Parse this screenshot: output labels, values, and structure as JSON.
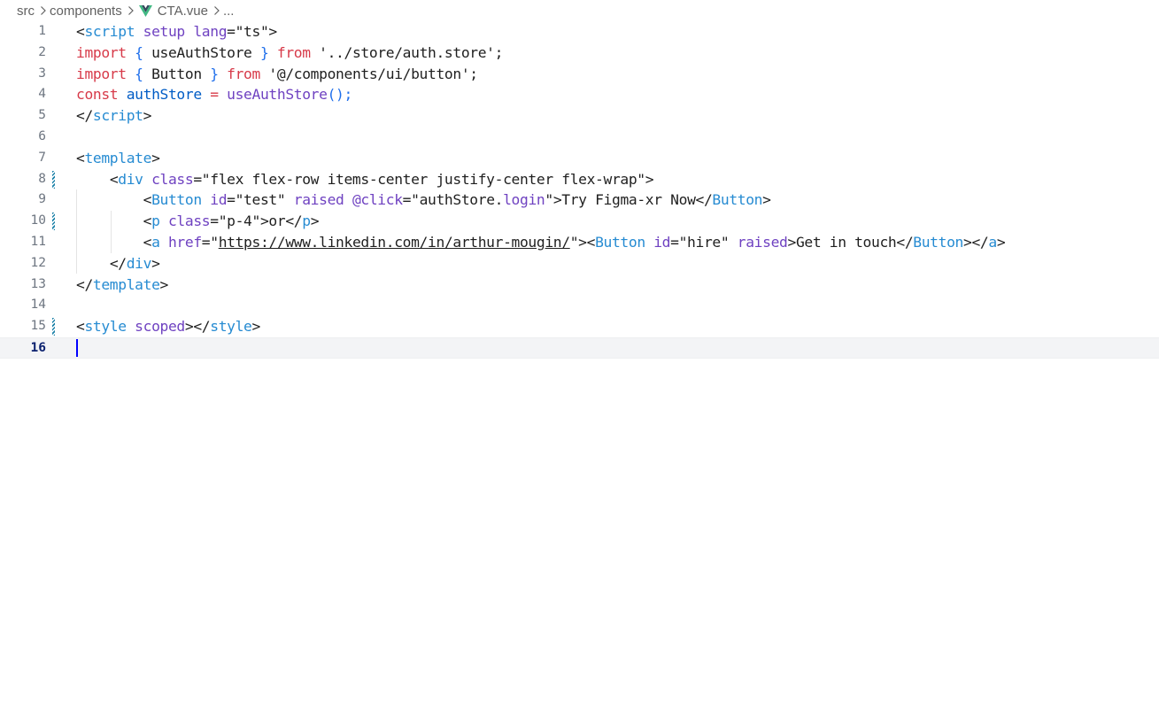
{
  "breadcrumb": {
    "items": [
      "src",
      "components",
      "CTA.vue",
      "..."
    ]
  },
  "editor": {
    "active_line": 16,
    "lines": [
      {
        "num": "1",
        "modified": false
      },
      {
        "num": "2",
        "modified": false
      },
      {
        "num": "3",
        "modified": false
      },
      {
        "num": "4",
        "modified": false
      },
      {
        "num": "5",
        "modified": false
      },
      {
        "num": "6",
        "modified": false
      },
      {
        "num": "7",
        "modified": false
      },
      {
        "num": "8",
        "modified": true
      },
      {
        "num": "9",
        "modified": false
      },
      {
        "num": "10",
        "modified": true
      },
      {
        "num": "11",
        "modified": false
      },
      {
        "num": "12",
        "modified": false
      },
      {
        "num": "13",
        "modified": false
      },
      {
        "num": "14",
        "modified": false
      },
      {
        "num": "15",
        "modified": true
      },
      {
        "num": "16",
        "modified": false
      }
    ],
    "code": {
      "l1": [
        "<",
        "script",
        " ",
        "setup",
        " ",
        "lang",
        "=",
        "\"ts\"",
        ">"
      ],
      "l2": [
        "import",
        " ",
        "{",
        " useAuthStore ",
        "}",
        " ",
        "from",
        " ",
        "'../store/auth.store'",
        ";"
      ],
      "l3": [
        "import",
        " ",
        "{",
        " Button ",
        "}",
        " ",
        "from",
        " ",
        "'@/components/ui/button'",
        ";"
      ],
      "l4": [
        "const",
        " ",
        "authStore",
        " ",
        "=",
        " ",
        "useAuthStore",
        "();"
      ],
      "l5": [
        "</",
        "script",
        ">"
      ],
      "l7": [
        "<",
        "template",
        ">"
      ],
      "l8": [
        "    ",
        "<",
        "div",
        " ",
        "class",
        "=",
        "\"flex flex-row items-center justify-center flex-wrap\"",
        ">"
      ],
      "l9": [
        "        ",
        "<",
        "Button",
        " ",
        "id",
        "=",
        "\"test\"",
        " ",
        "raised",
        " ",
        "@click",
        "=",
        "\"authStore.",
        "login",
        "\"",
        ">",
        "Try Figma-xr Now",
        "</",
        "Button",
        ">"
      ],
      "l10": [
        "        ",
        "<",
        "p",
        " ",
        "class",
        "=",
        "\"p-4\"",
        ">",
        "or",
        "</",
        "p",
        ">"
      ],
      "l11": [
        "        ",
        "<",
        "a",
        " ",
        "href",
        "=",
        "\"",
        "https://www.linkedin.com/in/arthur-mougin/",
        "\"",
        "><",
        "Button",
        " ",
        "id",
        "=",
        "\"hire\"",
        " ",
        "raised",
        ">",
        "Get in touch",
        "</",
        "Button",
        "></",
        "a",
        ">"
      ],
      "l12": [
        "    ",
        "</",
        "div",
        ">"
      ],
      "l13": [
        "</",
        "template",
        ">"
      ],
      "l15": [
        "<",
        "style",
        " ",
        "scoped",
        "></",
        "style",
        ">"
      ]
    }
  },
  "colors": {
    "background": "#ffffff",
    "line_number": "#6e7681",
    "active_line_number": "#0b216f",
    "current_line_bg": "#f3f4f6",
    "cursor": "#0000ff",
    "gutter_modified": "#1b81a8",
    "vue_logo": "#41b883"
  },
  "icons": {
    "breadcrumb_separator": "chevron-right-icon",
    "file_icon": "vue-file-icon"
  }
}
